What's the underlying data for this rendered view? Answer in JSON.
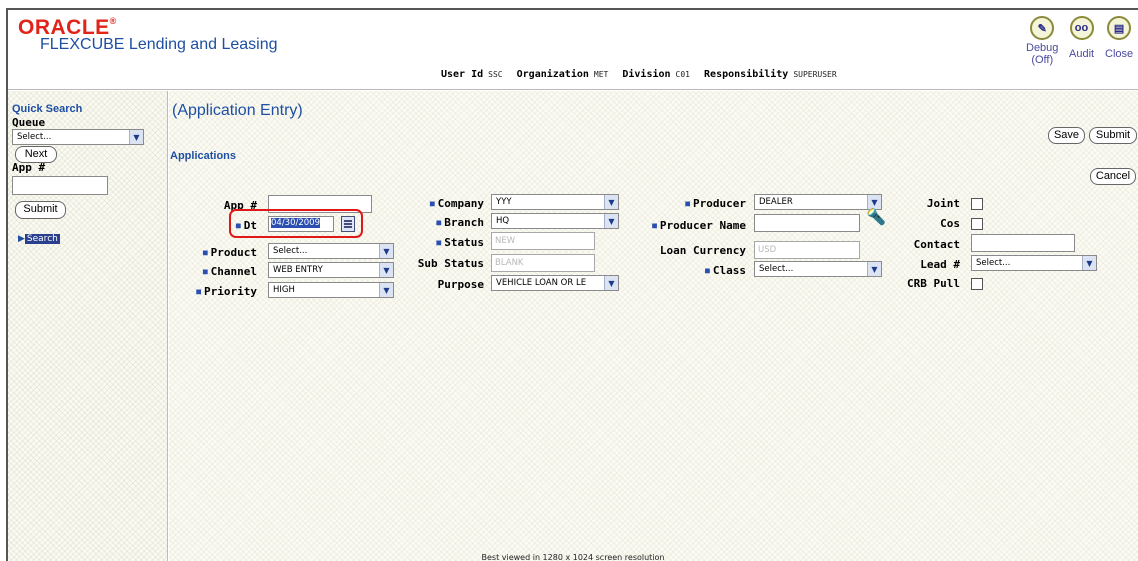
{
  "header": {
    "brand": "ORACLE",
    "brand_mark": "®",
    "product": "FLEXCUBE Lending and Leasing",
    "user_bar": {
      "user_id_label": "User Id",
      "user_id_value": "SSC",
      "organization_label": "Organization",
      "organization_value": "MET",
      "division_label": "Division",
      "division_value": "C01",
      "responsibility_label": "Responsibility",
      "responsibility_value": "SUPERUSER"
    },
    "icons": {
      "debug_label": "Debug",
      "debug_state": "(Off)",
      "audit_label": "Audit",
      "close_label": "Close"
    }
  },
  "quick_search": {
    "title": "Quick Search",
    "queue_label": "Queue",
    "queue_value": "Select...",
    "next_label": "Next",
    "app_label": "App #",
    "app_value": "",
    "submit_label": "Submit",
    "search_link": "Search"
  },
  "main": {
    "page_title": "(Application Entry)",
    "section_title": "Applications",
    "save_label": "Save",
    "submit_label": "Submit",
    "cancel_label": "Cancel",
    "fields": {
      "app_num_label": "App #",
      "app_num_value": "",
      "dt_label": "Dt",
      "dt_value": "04/30/2009",
      "product_label": "Product",
      "product_value": "Select...",
      "channel_label": "Channel",
      "channel_value": "WEB ENTRY",
      "priority_label": "Priority",
      "priority_value": "HIGH",
      "company_label": "Company",
      "company_value": "YYY",
      "branch_label": "Branch",
      "branch_value": "HQ",
      "status_label": "Status",
      "status_value": "NEW",
      "sub_status_label": "Sub Status",
      "sub_status_value": "BLANK",
      "purpose_label": "Purpose",
      "purpose_value": "VEHICLE LOAN OR LE",
      "producer_label": "Producer",
      "producer_value": "DEALER",
      "producer_name_label": "Producer Name",
      "producer_name_value": "",
      "loan_currency_label": "Loan Currency",
      "loan_currency_value": "USD",
      "class_label": "Class",
      "class_value": "Select...",
      "joint_label": "Joint",
      "cos_label": "Cos",
      "contact_label": "Contact",
      "contact_value": "",
      "lead_label": "Lead #",
      "lead_value": "Select...",
      "crb_pull_label": "CRB Pull"
    }
  },
  "footer": {
    "note": "Best viewed in 1280 x 1024 screen resolution"
  }
}
